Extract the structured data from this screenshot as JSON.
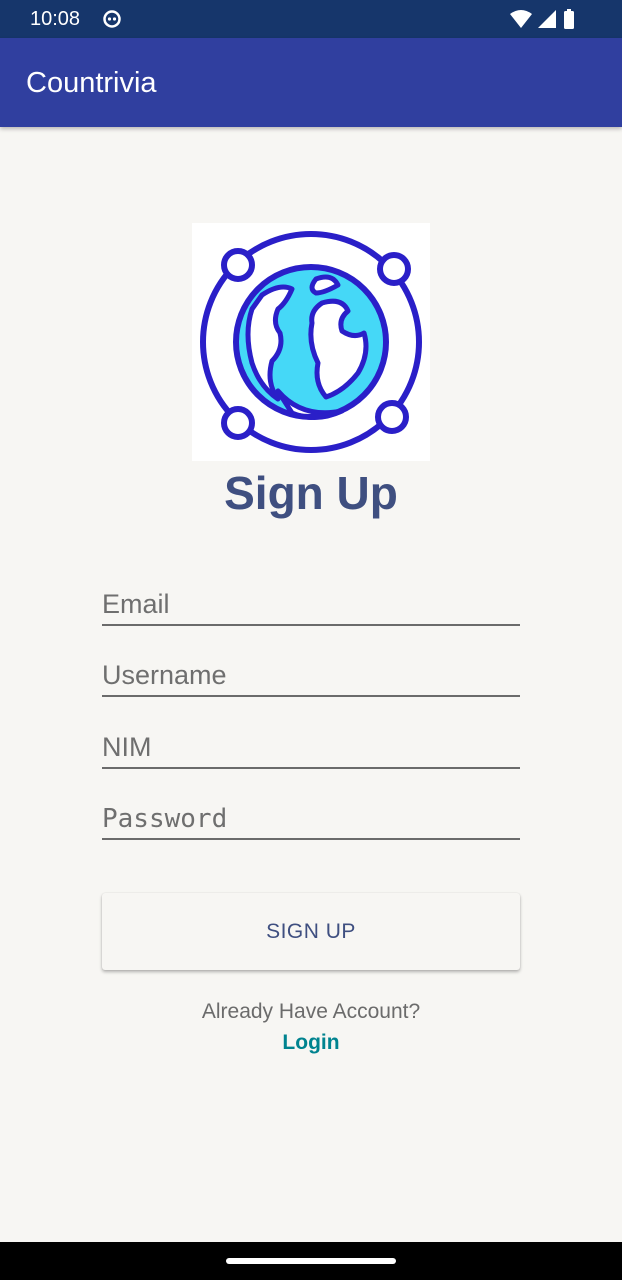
{
  "status_bar": {
    "time": "10:08",
    "notification_icon": "app-notification-icon",
    "icons": [
      "wifi-icon",
      "cellular-signal-icon",
      "battery-icon"
    ]
  },
  "app_bar": {
    "title": "Countrivia",
    "color": "#303f9f"
  },
  "logo": {
    "icon": "globe-orbit-icon",
    "colors": {
      "stroke": "#2a1fc8",
      "fill": "#45d8f7"
    }
  },
  "form": {
    "heading": "Sign Up",
    "email_placeholder": "Email",
    "username_placeholder": "Username",
    "nim_placeholder": "NIM",
    "password_placeholder": "Password",
    "submit_label": "SIGN UP"
  },
  "footer": {
    "prompt": "Already Have Account?",
    "login_label": "Login",
    "link_color": "#00838f"
  }
}
